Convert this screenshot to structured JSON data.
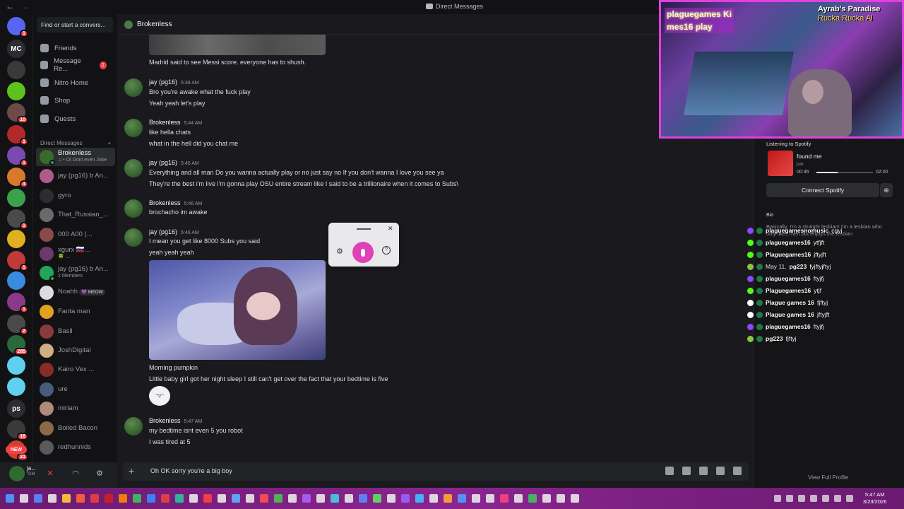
{
  "window": {
    "title": "Direct Messages",
    "back_glyph": "←",
    "forward_glyph": "→"
  },
  "rail": {
    "servers": [
      {
        "icon": "discord-home-icon",
        "color": "#5865f2",
        "badge": "1"
      },
      {
        "icon": "mc-icon",
        "color": "#2b2d31",
        "label": "MC"
      },
      {
        "icon": "ninja-icon",
        "color": "#3a3a3a"
      },
      {
        "icon": "frog-icon",
        "color": "#5dc21e"
      },
      {
        "icon": "server-icon",
        "color": "#6e4b4b",
        "badge": "10"
      },
      {
        "icon": "server-icon",
        "color": "#b02a2a",
        "badge": "1"
      },
      {
        "icon": "server-icon",
        "color": "#7a4ab0",
        "badge": "1"
      },
      {
        "icon": "server-icon",
        "color": "#d97a2a",
        "badge": "4"
      },
      {
        "icon": "server-icon",
        "color": "#3aa34a"
      },
      {
        "icon": "server-icon",
        "color": "#4a4a4a",
        "badge": "1"
      },
      {
        "icon": "server-icon",
        "color": "#e0b020"
      },
      {
        "icon": "server-icon",
        "color": "#c03a3a",
        "badge": "1"
      },
      {
        "icon": "server-icon",
        "color": "#3a8ae0"
      },
      {
        "icon": "server-icon",
        "color": "#8a3a8a",
        "badge": "1"
      },
      {
        "icon": "server-icon",
        "color": "#4a4a4a",
        "badge": "2"
      },
      {
        "icon": "server-icon",
        "color": "#2a6a3a",
        "badge": "285"
      },
      {
        "icon": "heart-icon",
        "color": "#5fd0f0"
      },
      {
        "icon": "heart-icon",
        "color": "#5fd0f0"
      },
      {
        "icon": "ps-icon",
        "color": "#2b2d31",
        "label": "ps"
      },
      {
        "icon": "server-icon",
        "color": "#3a3a3a",
        "badge": "16"
      },
      {
        "icon": "server-icon",
        "color": "#d0402a",
        "badge": "21"
      }
    ],
    "new_badge": "NEW"
  },
  "sidebar": {
    "search_placeholder": "Find or start a convers...",
    "nav": [
      {
        "label": "Friends"
      },
      {
        "label": "Message Re...",
        "badge": "1"
      },
      {
        "label": "Nitro Home"
      },
      {
        "label": "Shop"
      },
      {
        "label": "Quests"
      }
    ],
    "dm_header": "Direct Messages",
    "dm_add": "+",
    "dms": [
      {
        "name": "Brokenless",
        "sub": "♫ • Oi Dont even Joke",
        "color": "#3a6a2a",
        "active": true
      },
      {
        "name": "jay (pg16) b An...",
        "color": "#b05a8a"
      },
      {
        "name": "gyro",
        "color": "#2b2d31"
      },
      {
        "name": "That_Russian_...",
        "color": "#6a6a6a"
      },
      {
        "name": "000 A00 (...",
        "color": "#8a4a4a"
      },
      {
        "name": "xgurx 🇷🇺...",
        "sub": "🍀 ...",
        "color": "#6a3a6a"
      },
      {
        "name": "jay (pg16) b An...",
        "sub": "2 Members",
        "color": "#23a55a"
      },
      {
        "name": "Noahh",
        "tag": "💜 MEOW",
        "color": "#dbdee1"
      },
      {
        "name": "Fanta man",
        "color": "#e0a020"
      },
      {
        "name": "Basil",
        "color": "#8a3a3a"
      },
      {
        "name": "JoshDigital",
        "color": "#d0b080"
      },
      {
        "name": "Kairo Vex ...",
        "color": "#8a2a2a"
      },
      {
        "name": "ure",
        "color": "#4a5a7a"
      },
      {
        "name": "miriam",
        "color": "#b08a7a"
      },
      {
        "name": "Boiled Bacon",
        "color": "#8a6a4a"
      },
      {
        "name": "redhunnids",
        "color": "#5a5a5a"
      }
    ]
  },
  "user_panel": {
    "name": "ja...",
    "status": "\"DM"
  },
  "chat": {
    "recipient": "Brokenless",
    "messages": [
      {
        "type": "text",
        "text": "Madrid said to see Messi score. everyone has to shush."
      },
      {
        "author": "jay (pg16)",
        "time": "5:39 AM",
        "lines": [
          "Bro you're awake what the fuck play",
          "Yeah yeah let's play"
        ]
      },
      {
        "author": "Brokenless",
        "time": "5:44 AM",
        "lines": [
          "like hella chats",
          "what in the hell did you chat me"
        ]
      },
      {
        "author": "jay (pg16)",
        "time": "5:45 AM",
        "lines": [
          "Everything and all man Do you wanna actually play or no just say no If you don't wanna I love you see ya",
          "They're the best i'm live i'm gonna play OSU entire stream like I said to be a trillionaire when it comes to Subs\\"
        ]
      },
      {
        "author": "Brokenless",
        "time": "5:46 AM",
        "lines": [
          "brochacho im awake"
        ]
      },
      {
        "author": "jay (pg16)",
        "time": "5:46 AM",
        "lines": [
          "I mean you get like 8000 Subs you said",
          "yeah yeah yeah"
        ]
      },
      {
        "type": "continuation",
        "lines": [
          "Morning pumpkin",
          "Little baby girl got her night sleep I still can't get over the fact that your bedtime is five"
        ]
      },
      {
        "author": "Brokenless",
        "time": "5:47 AM",
        "lines": [
          "my bedtime isnt even 5 you robot",
          "I was tired at 5"
        ]
      }
    ],
    "sticker_glyph": "ᵔ▿ᵔ"
  },
  "composer": {
    "value": "Oh OK sorry you're a big boy",
    "plus_glyph": "+"
  },
  "mic_widget": {
    "close_glyph": "✕",
    "gear_glyph": "⚙",
    "help_glyph": "?"
  },
  "stream_overlay": {
    "left_text": "plaguegames Ki\nmes16 play",
    "right_title": "Ayrab's Paradise",
    "right_sub": "Rucka Rucka Al"
  },
  "profile": {
    "spotify_label": "Listening to Spotify",
    "track_title": "found me",
    "track_artist": "jssr",
    "elapsed": "00:46",
    "total": "02:00",
    "progress": 0.38,
    "connect_label": "Connect Spotify",
    "bio_label": "Bio",
    "bio_text": "Basically, I'm a straight lesbian! I'm a lesbian who only likes men but enjoys the lesbian",
    "view_full": "View Full Profile"
  },
  "stream_chat": [
    {
      "platform": "twitch",
      "color": "#9146ff",
      "name": "plaguegamesnomusic",
      "msg": "cgyj"
    },
    {
      "platform": "kick",
      "color": "#53fc18",
      "name": "plaguegames16",
      "msg": "ytfjft"
    },
    {
      "platform": "kick",
      "color": "#53fc18",
      "name": "Plaguegames16",
      "msg": "jftyjft"
    },
    {
      "platform": "rumble",
      "color": "#85c742",
      "prefix": "May 11,",
      "name": "pg223",
      "msg": "fyjftyjftyj"
    },
    {
      "platform": "twitch",
      "color": "#9146ff",
      "name": "plaguegames16",
      "msg": "ftyjfj"
    },
    {
      "platform": "kick",
      "color": "#53fc18",
      "name": "Plaguegames16",
      "msg": "ytjf"
    },
    {
      "platform": "x",
      "color": "#ffffff",
      "name": "Plague games 16",
      "msg": "fjftyj"
    },
    {
      "platform": "x",
      "color": "#ffffff",
      "name": "Plague games 16",
      "msg": "jftyjft"
    },
    {
      "platform": "twitch",
      "color": "#9146ff",
      "name": "plaguegames16",
      "msg": "ftyjfj"
    },
    {
      "platform": "rumble",
      "color": "#85c742",
      "name": "pg223",
      "msg": "fjftyj"
    }
  ],
  "taskbar": {
    "time": "5:47 AM",
    "date": "3/23/2026",
    "icon_colors": [
      "#4aa0ff",
      "#e8e8e8",
      "#5a8aff",
      "#e8e8e8",
      "#ffcc33",
      "#ff6633",
      "#e84040",
      "#d02020",
      "#ff8800",
      "#40c060",
      "#3a8aff",
      "#e84040",
      "#30c0a0",
      "#e8e8e8",
      "#ff4040",
      "#e8e8e8",
      "#60b0ff",
      "#e8e8e8",
      "#ff5050",
      "#50c050",
      "#e8e8e8",
      "#aa60ff",
      "#e8e8e8",
      "#40d0e0",
      "#e8e8e8",
      "#5a8aff",
      "#60e060",
      "#e8e8e8",
      "#9a60ff",
      "#40c0ff",
      "#e8e8e8",
      "#ffaa33",
      "#4aa0ff",
      "#e8e8e8",
      "#e8e8e8",
      "#ff4080",
      "#e8e8e8",
      "#40c060",
      "#e8e8e8",
      "#e8e8e8",
      "#e8e8e8"
    ]
  }
}
